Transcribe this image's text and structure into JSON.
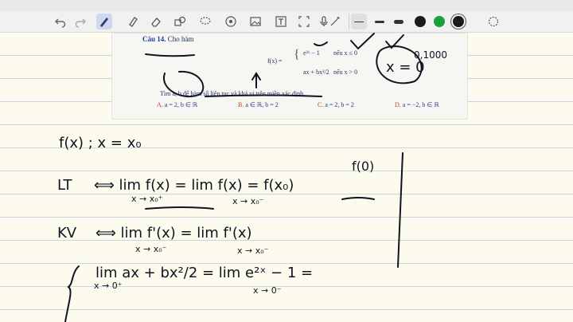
{
  "app": {
    "name": "Notes"
  },
  "toolbar": {
    "icons": [
      "undo-icon",
      "redo-icon",
      "pen-icon",
      "highlighter-icon",
      "eraser-icon",
      "lasso-icon",
      "shapes-icon",
      "image-icon",
      "text-icon",
      "scan-icon",
      "microphone-icon",
      "color-picker-icon"
    ],
    "pen_colors": [
      "#ffffff",
      "#1a1a1a",
      "#1aa13a",
      "#cc1818",
      "#1a6ee0",
      "#1a1a1a"
    ],
    "active_tool": "pen"
  },
  "doc": {
    "title_label": "Câu 14.",
    "title_text": "Cho hàm",
    "fx": "f(x) =",
    "case1_expr": "e²ˣ − 1",
    "case1_cond": "nếu x ≤ 0",
    "case2_expr": "ax + bx²/2",
    "case2_cond": "nếu x > 0",
    "question": "Tìm a, b để hàm số liên tục và khả vi trên miền xác định.",
    "options": [
      {
        "letter": "A.",
        "text": "a = 2, b ∈ ℝ"
      },
      {
        "letter": "B.",
        "text": "a ∈ ℝ, b = 2"
      },
      {
        "letter": "C.",
        "text": "a = 2, b = 2"
      },
      {
        "letter": "D.",
        "text": "a = −2, b ∈ ℝ"
      }
    ]
  },
  "handwriting": {
    "ann_x0": "x = 0",
    "ann_ones": "0,1000",
    "line1": "f(x) ; x = x₀",
    "lt_label": "LT",
    "lt_eq": "⟺ lim f(x) = lim f(x) = f(x₀)",
    "lt_sub1": "x → x₀⁺",
    "lt_sub2": "x → x₀⁻",
    "lt_f0": "f(0)",
    "kv_label": "KV",
    "kv_eq": "⟺ lim f'(x) = lim f'(x)",
    "kv_sub1": "x → x₀⁻",
    "kv_sub2": "x → x₀⁻",
    "line4": "lim ax + bx²/2 = lim e²ˣ − 1 =",
    "line4_sub1": "x → 0⁺",
    "line4_sub2": "x → 0⁻"
  }
}
